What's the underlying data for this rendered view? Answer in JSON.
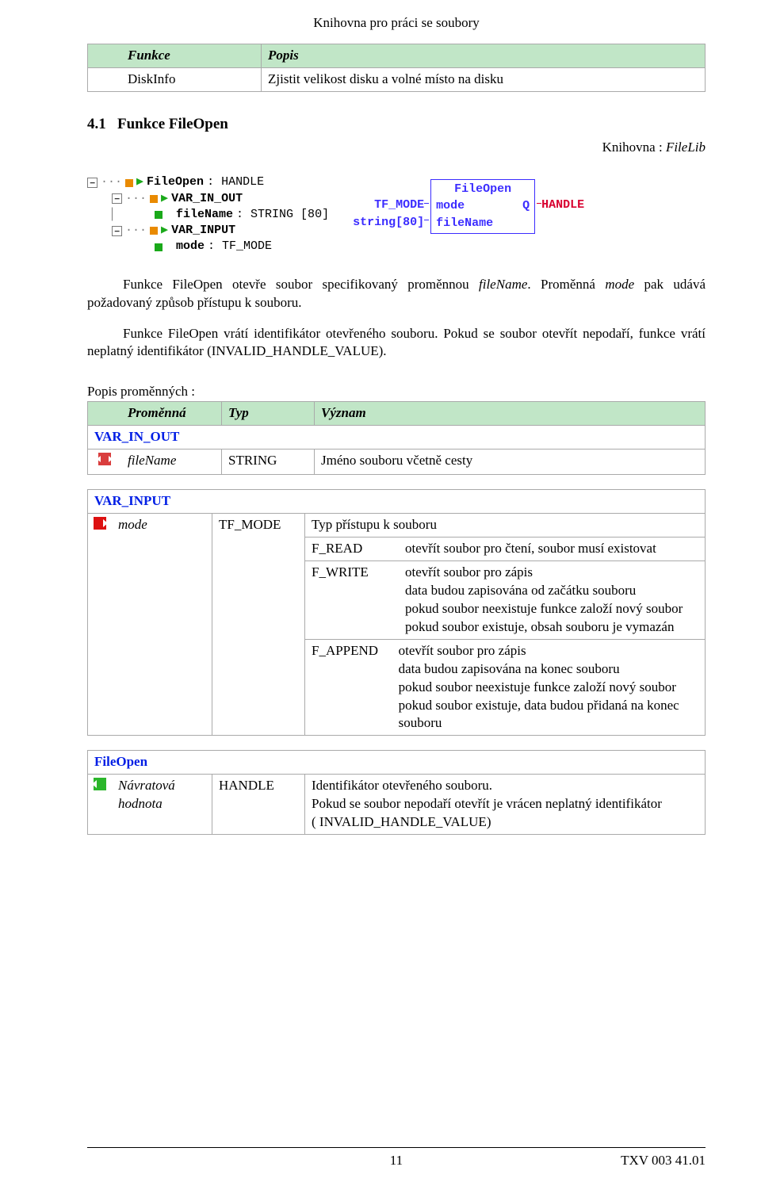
{
  "doc_header": "Knihovna pro práci se soubory",
  "table_funkce": {
    "headers": [
      "Funkce",
      "Popis"
    ],
    "row": {
      "name": "DiskInfo",
      "desc": "Zjistit velikost disku a volné místo na disku"
    }
  },
  "section": {
    "number": "4.1",
    "title": "Funkce FileOpen"
  },
  "lib_line": {
    "prefix": "Knihovna : ",
    "name": "FileLib"
  },
  "tree": {
    "root": {
      "text": "FileOpen",
      "after_colon": " : HANDLE"
    },
    "var_in_out": {
      "label": "VAR_IN_OUT",
      "child": {
        "name": "fileName",
        "type": " : STRING [80]"
      }
    },
    "var_input": {
      "label": "VAR_INPUT",
      "child": {
        "name": "mode",
        "type": " : TF_MODE"
      }
    }
  },
  "fb": {
    "title": "FileOpen",
    "left1": "TF_MODE",
    "in1": "mode",
    "out1": "Q",
    "right1": "HANDLE",
    "left2": "string[80]",
    "in2": "fileName"
  },
  "paragraphs": {
    "p1a": "Funkce FileOpen otevře soubor specifikovaný proměnnou ",
    "p1b_it": "fileName",
    "p1c": ". Proměnná ",
    "p1d_it": "mode",
    "p1e": " pak udává požadovaný způsob přístupu k souboru.",
    "p2": "Funkce FileOpen vrátí identifikátor otevřeného souboru. Pokud se soubor otevřít nepodaří, funkce vrátí neplatný identifikátor (INVALID_HANDLE_VALUE)."
  },
  "popis_label": "Popis proměnných :",
  "pop_table": {
    "headers": [
      "Proměnná",
      "Typ",
      "Význam"
    ],
    "var_in_out_label": "VAR_IN_OUT",
    "filename_row": {
      "var": "fileName",
      "type": "STRING",
      "desc": "Jméno souboru včetně cesty"
    },
    "var_input_label": "VAR_INPUT",
    "mode_row": {
      "var": "mode",
      "type": "TF_MODE",
      "desc_header": "Typ přístupu k souboru",
      "fread": {
        "name": "F_READ",
        "desc": "otevřít soubor pro čtení, soubor musí existovat"
      },
      "fwrite": {
        "name": "F_WRITE",
        "desc": "otevřít soubor pro zápis\ndata budou zapisována od začátku souboru\npokud soubor neexistuje funkce založí nový soubor\npokud soubor existuje, obsah souboru je vymazán"
      },
      "fappend": {
        "name": "F_APPEND",
        "desc": "otevřít soubor pro zápis\ndata budou zapisována na konec souboru\npokud soubor neexistuje funkce založí nový soubor\npokud soubor existuje, data budou přidaná na konec souboru"
      }
    },
    "fileopen_label": "FileOpen",
    "return_row": {
      "var": "Návratová hodnota",
      "type": "HANDLE",
      "desc": "Identifikátor otevřeného souboru.\nPokud se soubor nepodaří otevřít je vrácen neplatný identifikátor\n( INVALID_HANDLE_VALUE)"
    }
  },
  "footer": {
    "page": "11",
    "docnum": "TXV 003 41.01"
  }
}
